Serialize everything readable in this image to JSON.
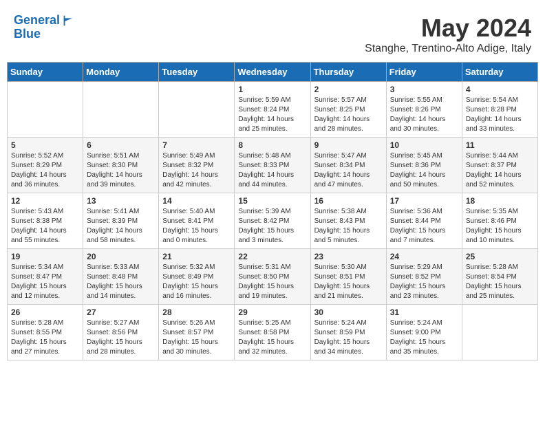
{
  "header": {
    "logo_line1": "General",
    "logo_line2": "Blue",
    "month": "May 2024",
    "location": "Stanghe, Trentino-Alto Adige, Italy"
  },
  "weekdays": [
    "Sunday",
    "Monday",
    "Tuesday",
    "Wednesday",
    "Thursday",
    "Friday",
    "Saturday"
  ],
  "weeks": [
    [
      {
        "day": "",
        "info": ""
      },
      {
        "day": "",
        "info": ""
      },
      {
        "day": "",
        "info": ""
      },
      {
        "day": "1",
        "info": "Sunrise: 5:59 AM\nSunset: 8:24 PM\nDaylight: 14 hours and 25 minutes."
      },
      {
        "day": "2",
        "info": "Sunrise: 5:57 AM\nSunset: 8:25 PM\nDaylight: 14 hours and 28 minutes."
      },
      {
        "day": "3",
        "info": "Sunrise: 5:55 AM\nSunset: 8:26 PM\nDaylight: 14 hours and 30 minutes."
      },
      {
        "day": "4",
        "info": "Sunrise: 5:54 AM\nSunset: 8:28 PM\nDaylight: 14 hours and 33 minutes."
      }
    ],
    [
      {
        "day": "5",
        "info": "Sunrise: 5:52 AM\nSunset: 8:29 PM\nDaylight: 14 hours and 36 minutes."
      },
      {
        "day": "6",
        "info": "Sunrise: 5:51 AM\nSunset: 8:30 PM\nDaylight: 14 hours and 39 minutes."
      },
      {
        "day": "7",
        "info": "Sunrise: 5:49 AM\nSunset: 8:32 PM\nDaylight: 14 hours and 42 minutes."
      },
      {
        "day": "8",
        "info": "Sunrise: 5:48 AM\nSunset: 8:33 PM\nDaylight: 14 hours and 44 minutes."
      },
      {
        "day": "9",
        "info": "Sunrise: 5:47 AM\nSunset: 8:34 PM\nDaylight: 14 hours and 47 minutes."
      },
      {
        "day": "10",
        "info": "Sunrise: 5:45 AM\nSunset: 8:36 PM\nDaylight: 14 hours and 50 minutes."
      },
      {
        "day": "11",
        "info": "Sunrise: 5:44 AM\nSunset: 8:37 PM\nDaylight: 14 hours and 52 minutes."
      }
    ],
    [
      {
        "day": "12",
        "info": "Sunrise: 5:43 AM\nSunset: 8:38 PM\nDaylight: 14 hours and 55 minutes."
      },
      {
        "day": "13",
        "info": "Sunrise: 5:41 AM\nSunset: 8:39 PM\nDaylight: 14 hours and 58 minutes."
      },
      {
        "day": "14",
        "info": "Sunrise: 5:40 AM\nSunset: 8:41 PM\nDaylight: 15 hours and 0 minutes."
      },
      {
        "day": "15",
        "info": "Sunrise: 5:39 AM\nSunset: 8:42 PM\nDaylight: 15 hours and 3 minutes."
      },
      {
        "day": "16",
        "info": "Sunrise: 5:38 AM\nSunset: 8:43 PM\nDaylight: 15 hours and 5 minutes."
      },
      {
        "day": "17",
        "info": "Sunrise: 5:36 AM\nSunset: 8:44 PM\nDaylight: 15 hours and 7 minutes."
      },
      {
        "day": "18",
        "info": "Sunrise: 5:35 AM\nSunset: 8:46 PM\nDaylight: 15 hours and 10 minutes."
      }
    ],
    [
      {
        "day": "19",
        "info": "Sunrise: 5:34 AM\nSunset: 8:47 PM\nDaylight: 15 hours and 12 minutes."
      },
      {
        "day": "20",
        "info": "Sunrise: 5:33 AM\nSunset: 8:48 PM\nDaylight: 15 hours and 14 minutes."
      },
      {
        "day": "21",
        "info": "Sunrise: 5:32 AM\nSunset: 8:49 PM\nDaylight: 15 hours and 16 minutes."
      },
      {
        "day": "22",
        "info": "Sunrise: 5:31 AM\nSunset: 8:50 PM\nDaylight: 15 hours and 19 minutes."
      },
      {
        "day": "23",
        "info": "Sunrise: 5:30 AM\nSunset: 8:51 PM\nDaylight: 15 hours and 21 minutes."
      },
      {
        "day": "24",
        "info": "Sunrise: 5:29 AM\nSunset: 8:52 PM\nDaylight: 15 hours and 23 minutes."
      },
      {
        "day": "25",
        "info": "Sunrise: 5:28 AM\nSunset: 8:54 PM\nDaylight: 15 hours and 25 minutes."
      }
    ],
    [
      {
        "day": "26",
        "info": "Sunrise: 5:28 AM\nSunset: 8:55 PM\nDaylight: 15 hours and 27 minutes."
      },
      {
        "day": "27",
        "info": "Sunrise: 5:27 AM\nSunset: 8:56 PM\nDaylight: 15 hours and 28 minutes."
      },
      {
        "day": "28",
        "info": "Sunrise: 5:26 AM\nSunset: 8:57 PM\nDaylight: 15 hours and 30 minutes."
      },
      {
        "day": "29",
        "info": "Sunrise: 5:25 AM\nSunset: 8:58 PM\nDaylight: 15 hours and 32 minutes."
      },
      {
        "day": "30",
        "info": "Sunrise: 5:24 AM\nSunset: 8:59 PM\nDaylight: 15 hours and 34 minutes."
      },
      {
        "day": "31",
        "info": "Sunrise: 5:24 AM\nSunset: 9:00 PM\nDaylight: 15 hours and 35 minutes."
      },
      {
        "day": "",
        "info": ""
      }
    ]
  ]
}
